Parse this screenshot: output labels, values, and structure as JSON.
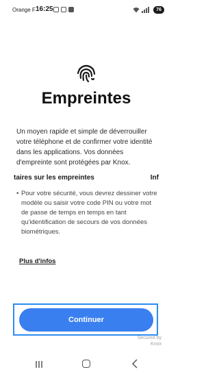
{
  "status_bar": {
    "carrier": "Orange F",
    "time": "16:25",
    "battery": "76"
  },
  "page": {
    "title": "Empreintes",
    "description": "Un moyen rapide et simple de déverrouiller votre téléphone et de confirmer votre identité dans les applications. Vos données d'empreinte sont protégées par Knox."
  },
  "tabs": {
    "left_label": "taires sur les empreintes",
    "right_label": "Inf"
  },
  "info": {
    "bullet": "•",
    "text": "Pour votre sécurité, vous devrez dessiner votre modèle ou saisir votre code PIN ou votre mot de passe de temps en temps en tant qu'identification de secours de vos données biométriques.",
    "more_link": "Plus d'infos"
  },
  "actions": {
    "continue_label": "Continuer"
  },
  "footer": {
    "secured_line1": "Secured by",
    "secured_line2": "Knox"
  },
  "icons": {
    "main": "fingerprint-icon",
    "nav": [
      "recents-icon",
      "home-icon",
      "back-icon"
    ]
  },
  "colors": {
    "accent": "#3a7ff0",
    "focus_frame": "#2d8cf0"
  }
}
